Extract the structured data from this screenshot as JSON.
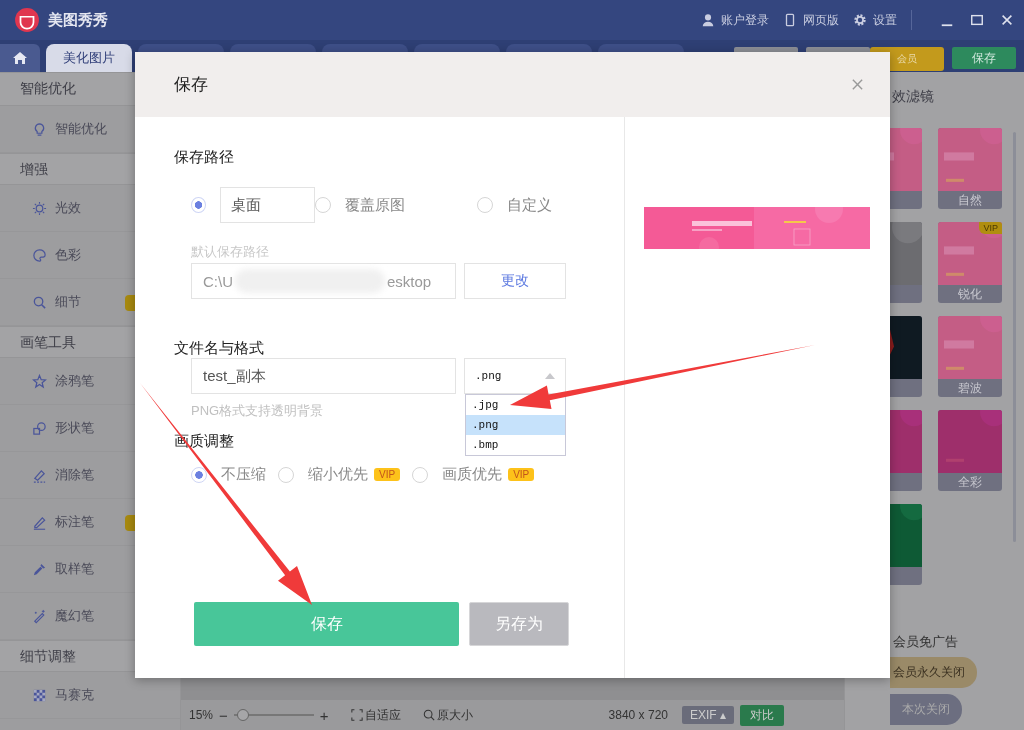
{
  "title_bar": {
    "app_name": "美图秀秀",
    "account": "账户登录",
    "web": "网页版",
    "settings": "设置"
  },
  "tabs": [
    {
      "label": "美化图片",
      "selected": true
    }
  ],
  "toolbar_buttons": [
    {
      "kind": "plain"
    },
    {
      "kind": "plain"
    },
    {
      "kind": "vip",
      "label": "会员"
    },
    {
      "kind": "save",
      "label": "保存"
    }
  ],
  "sidebar": [
    {
      "title": "智能优化",
      "items": [
        {
          "label": "智能优化",
          "badge": false
        }
      ]
    },
    {
      "title": "增强",
      "items": [
        {
          "label": "光效",
          "badge": false
        },
        {
          "label": "色彩",
          "badge": false
        },
        {
          "label": "细节",
          "badge": true
        }
      ]
    },
    {
      "title": "画笔工具",
      "items": [
        {
          "label": "涂鸦笔",
          "badge": false
        },
        {
          "label": "形状笔",
          "badge": false
        },
        {
          "label": "消除笔",
          "badge": false
        },
        {
          "label": "标注笔",
          "badge": true
        },
        {
          "label": "取样笔",
          "badge": false
        },
        {
          "label": "魔幻笔",
          "badge": false
        }
      ]
    },
    {
      "title": "细节调整",
      "items": [
        {
          "label": "马赛克",
          "badge": false
        }
      ]
    }
  ],
  "status_bar": {
    "zoom": "15%",
    "zoom_out": "−",
    "zoom_in": "+",
    "zoom_slider": {
      "level": 0.05
    },
    "fit": "自适应",
    "original": "原大小",
    "size": "3840 x 720",
    "exif": "EXIF",
    "exif_caret": "▴",
    "compare": "对比"
  },
  "right_panel": {
    "title": "效滤镜",
    "cards": [
      {
        "label": "自然"
      },
      {
        "label": "锐化",
        "badge": "VIP"
      },
      {
        "label": "碧波"
      },
      {
        "label": "全彩"
      }
    ],
    "ad_text": "会员免广告",
    "close_forever": "会员永久关闭",
    "close_once": "本次关闭"
  },
  "dialog": {
    "title": "保存",
    "path_heading": "保存路径",
    "path_options": [
      {
        "label": "桌面",
        "selected": true
      },
      {
        "label": "覆盖原图",
        "selected": false
      },
      {
        "label": "自定义",
        "selected": false
      }
    ],
    "default_path_label": "默认保存路径",
    "path_start": "C:\\U",
    "path_end": "esktop",
    "change_button": "更改",
    "name_heading": "文件名与格式",
    "file_name": "test_副本",
    "format": ".png",
    "format_options": [
      {
        "label": ".jpg",
        "selected": false
      },
      {
        "label": ".png",
        "selected": true
      },
      {
        "label": ".bmp",
        "selected": false
      }
    ],
    "hint": "PNG格式支持透明背景",
    "quality_heading": "画质调整",
    "quality_options": [
      {
        "label": "不压缩",
        "selected": true
      },
      {
        "label": "缩小优先",
        "selected": false,
        "badge": "VIP"
      },
      {
        "label": "画质优先",
        "selected": false,
        "badge": "VIP"
      }
    ],
    "save_button": "保存",
    "save_as_button": "另存为",
    "save_as_disabled": true
  }
}
